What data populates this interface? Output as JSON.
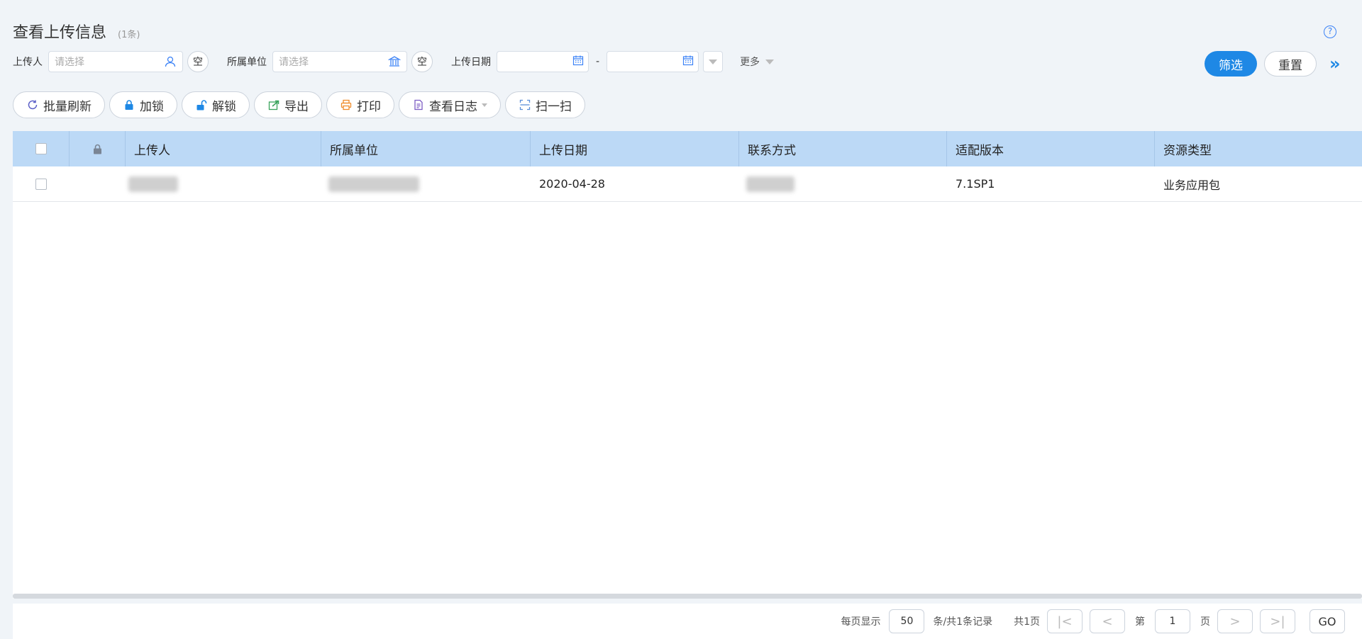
{
  "header": {
    "title": "查看上传信息",
    "count": "(1条)",
    "help": "?"
  },
  "filters": {
    "uploader_label": "上传人",
    "uploader_placeholder": "请选择",
    "clear_label": "空",
    "unit_label": "所属单位",
    "unit_placeholder": "请选择",
    "date_label": "上传日期",
    "date_separator": "-",
    "more_label": "更多"
  },
  "actions": {
    "filter": "筛选",
    "reset": "重置",
    "expand": "»"
  },
  "toolbar": [
    {
      "label": "批量刷新",
      "icon": "refresh-icon"
    },
    {
      "label": "加锁",
      "icon": "lock-icon"
    },
    {
      "label": "解锁",
      "icon": "unlock-icon"
    },
    {
      "label": "导出",
      "icon": "export-icon"
    },
    {
      "label": "打印",
      "icon": "print-icon"
    },
    {
      "label": "查看日志",
      "icon": "log-icon"
    },
    {
      "label": "扫一扫",
      "icon": "scan-icon"
    }
  ],
  "table": {
    "columns": [
      "上传人",
      "所属单位",
      "上传日期",
      "联系方式",
      "适配版本",
      "资源类型"
    ],
    "rows": [
      {
        "date": "2020-04-28",
        "version": "7.1SP1",
        "type": "业务应用包"
      }
    ]
  },
  "pager": {
    "per_page_label": "每页显示",
    "per_page": "50",
    "records": "条/共1条记录",
    "total_pages": "共1页",
    "page_prefix": "第",
    "page": "1",
    "page_suffix": "页",
    "go": "GO"
  },
  "colors": {
    "accent": "#1e88e5",
    "header_bg": "#bcd9f6"
  }
}
